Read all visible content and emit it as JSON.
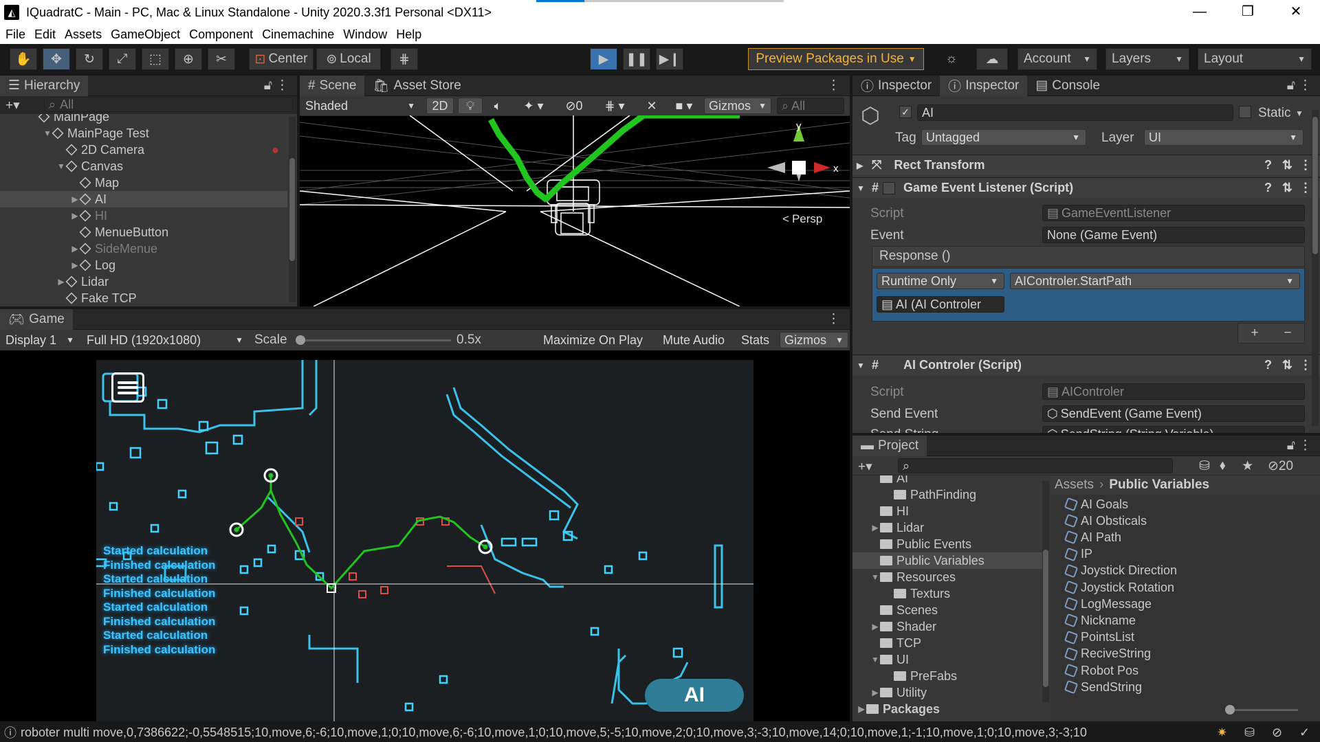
{
  "window": {
    "title": "IQuadratC - Main - PC, Mac & Linux Standalone - Unity 2020.3.3f1 Personal <DX11>",
    "minimize": "—",
    "maximize": "❐",
    "close": "✕"
  },
  "menu": [
    "File",
    "Edit",
    "Assets",
    "GameObject",
    "Component",
    "Cinemachine",
    "Window",
    "Help"
  ],
  "toolbar": {
    "pivot": "Center",
    "space": "Local",
    "preview": "Preview Packages in Use",
    "account": "Account",
    "layers": "Layers",
    "layout": "Layout"
  },
  "hierarchy": {
    "tab": "Hierarchy",
    "search_placeholder": "All",
    "items": [
      {
        "label": "MainPage",
        "indent": 0
      },
      {
        "label": "MainPage Test",
        "indent": 1,
        "arrow": "▼"
      },
      {
        "label": "2D Camera",
        "indent": 2
      },
      {
        "label": "Canvas",
        "indent": 2,
        "arrow": "▼"
      },
      {
        "label": "Map",
        "indent": 3
      },
      {
        "label": "AI",
        "indent": 3,
        "arrow": "▶",
        "selected": true
      },
      {
        "label": "HI",
        "indent": 3,
        "arrow": "▶",
        "dim": true
      },
      {
        "label": "MenueButton",
        "indent": 3
      },
      {
        "label": "SideMenue",
        "indent": 3,
        "arrow": "▶",
        "dim": true
      },
      {
        "label": "Log",
        "indent": 3,
        "arrow": "▶"
      },
      {
        "label": "Lidar",
        "indent": 2,
        "arrow": "▶"
      },
      {
        "label": "Fake TCP",
        "indent": 2
      }
    ]
  },
  "scene": {
    "tabs": [
      "Scene",
      "Asset Store"
    ],
    "shading": "Shaded",
    "mode2d": "2D",
    "hidden_count": "0",
    "gizmos": "Gizmos",
    "search_placeholder": "All",
    "persp": "Persp",
    "axis_y": "y",
    "axis_x": "x"
  },
  "game": {
    "tab": "Game",
    "display": "Display 1",
    "resolution": "Full HD (1920x1080)",
    "scale_label": "Scale",
    "scale_value": "0.5x",
    "maximize": "Maximize On Play",
    "mute": "Mute Audio",
    "stats": "Stats",
    "gizmos": "Gizmos",
    "ai_button": "AI",
    "log": [
      "Started calculation",
      "Finished calculation",
      "Started calculation",
      "Finished calculation",
      "Started calculation",
      "Finished calculation",
      "Started calculation",
      "Finished calculation"
    ]
  },
  "inspector": {
    "tabs": [
      "Inspector",
      "Inspector",
      "Console"
    ],
    "object_name": "AI",
    "static": "Static",
    "tag_label": "Tag",
    "tag": "Untagged",
    "layer_label": "Layer",
    "layer": "UI",
    "rect_transform": "Rect Transform",
    "listener": {
      "title": "Game Event Listener (Script)",
      "script_label": "Script",
      "script": "GameEventListener",
      "event_label": "Event",
      "event": "None (Game Event)",
      "response": "Response ()",
      "runtime": "Runtime Only",
      "method": "AIControler.StartPath",
      "target": "AI (AI Controler"
    },
    "controler": {
      "title": "AI Controler (Script)",
      "script_label": "Script",
      "script": "AIControler",
      "send_event_label": "Send Event",
      "send_event": "SendEvent (Game Event)",
      "send_string_label": "Send String",
      "send_string": "SendString (String Variable)"
    }
  },
  "project": {
    "tab": "Project",
    "hidden_count": "20",
    "breadcrumb_root": "Assets",
    "breadcrumb_leaf": "Public Variables",
    "tree": [
      {
        "label": "AI",
        "indent": 1
      },
      {
        "label": "PathFinding",
        "indent": 2
      },
      {
        "label": "HI",
        "indent": 1
      },
      {
        "label": "Lidar",
        "indent": 1,
        "arrow": "▶"
      },
      {
        "label": "Public Events",
        "indent": 1
      },
      {
        "label": "Public Variables",
        "indent": 1,
        "selected": true
      },
      {
        "label": "Resources",
        "indent": 1,
        "arrow": "▼"
      },
      {
        "label": "Texturs",
        "indent": 2
      },
      {
        "label": "Scenes",
        "indent": 1
      },
      {
        "label": "Shader",
        "indent": 1,
        "arrow": "▶"
      },
      {
        "label": "TCP",
        "indent": 1
      },
      {
        "label": "UI",
        "indent": 1,
        "arrow": "▼"
      },
      {
        "label": "PreFabs",
        "indent": 2
      },
      {
        "label": "Utility",
        "indent": 1,
        "arrow": "▶"
      },
      {
        "label": "Packages",
        "indent": 0,
        "arrow": "▶",
        "bold": true
      }
    ],
    "assets": [
      "AI Goals",
      "AI Obsticals",
      "AI Path",
      "IP",
      "Joystick Direction",
      "Joystick Rotation",
      "LogMessage",
      "Nickname",
      "PointsList",
      "ReciveString",
      "Robot Pos",
      "SendString"
    ]
  },
  "status": {
    "message": "roboter multi move,0,7386622;-0,5548515;10,move,6;-6;10,move,1;0;10,move,6;-6;10,move,1;0;10,move,5;-5;10,move,2;0;10,move,3;-3;10,move,14;0;10,move,1;-1;10,move,1;0;10,move,3;-3;10"
  },
  "colors": {
    "accent": "#46607c",
    "path_green": "#22c41f",
    "neon_blue": "#3fd4ff",
    "selection": "#2c5d87"
  }
}
